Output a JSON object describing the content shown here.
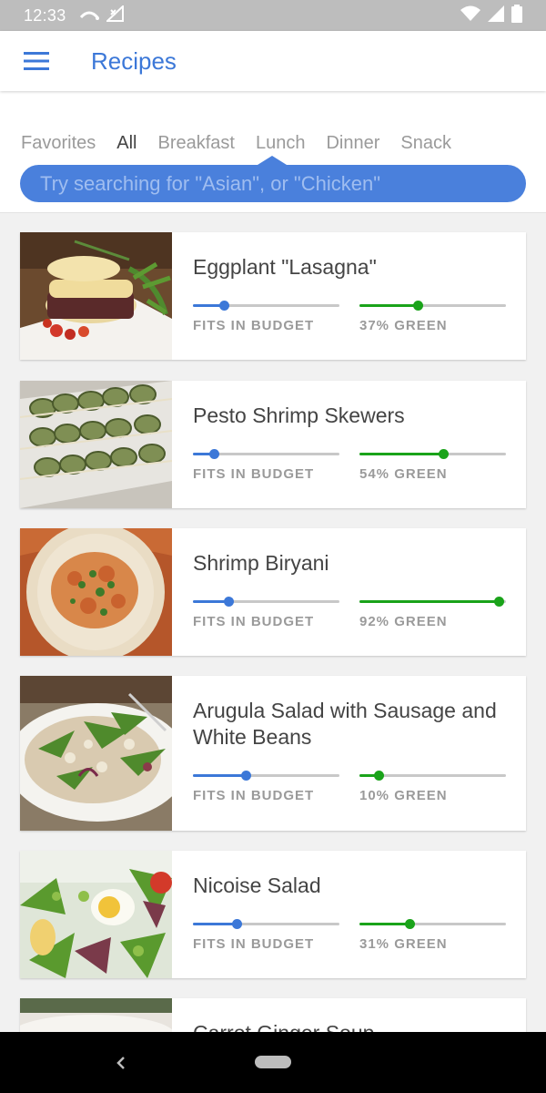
{
  "status_bar": {
    "time": "12:33",
    "icons": [
      "sync-icon",
      "no-signal-icon",
      "wifi-icon",
      "cell-signal-icon",
      "battery-icon"
    ]
  },
  "app_bar": {
    "title": "Recipes",
    "menu_icon": "hamburger-menu-icon"
  },
  "tabs": [
    {
      "label": "Favorites",
      "active": false
    },
    {
      "label": "All",
      "active": true
    },
    {
      "label": "Breakfast",
      "active": false
    },
    {
      "label": "Lunch",
      "active": false
    },
    {
      "label": "Dinner",
      "active": false
    },
    {
      "label": "Snack",
      "active": false
    }
  ],
  "search": {
    "placeholder": "Try searching for \"Asian\", or \"Chicken\"",
    "value": ""
  },
  "colors": {
    "accent": "#3c78d8",
    "budget": "#3c78d8",
    "green": "#1aa31a"
  },
  "recipes": [
    {
      "title": "Eggplant \"Lasagna\"",
      "budget_label": "FITS IN BUDGET",
      "budget_level": 0.21,
      "green_label": "37% GREEN",
      "green_level": 0.4,
      "photo": "eggplant-lasagna"
    },
    {
      "title": "Pesto Shrimp Skewers",
      "budget_label": "FITS IN BUDGET",
      "budget_level": 0.14,
      "green_label": "54% GREEN",
      "green_level": 0.57,
      "photo": "pesto-shrimp"
    },
    {
      "title": "Shrimp Biryani",
      "budget_label": "FITS IN BUDGET",
      "budget_level": 0.24,
      "green_label": "92% GREEN",
      "green_level": 0.95,
      "photo": "shrimp-biryani"
    },
    {
      "title": "Arugula Salad with Sausage and White Beans",
      "budget_label": "FITS IN BUDGET",
      "budget_level": 0.36,
      "green_label": "10% GREEN",
      "green_level": 0.13,
      "photo": "arugula-salad"
    },
    {
      "title": "Nicoise Salad",
      "budget_label": "FITS IN BUDGET",
      "budget_level": 0.3,
      "green_label": "31% GREEN",
      "green_level": 0.34,
      "photo": "nicoise-salad"
    },
    {
      "title": "Carrot Ginger Soup",
      "budget_label": "",
      "budget_level": null,
      "green_label": "",
      "green_level": null,
      "photo": "carrot-ginger-soup"
    }
  ]
}
